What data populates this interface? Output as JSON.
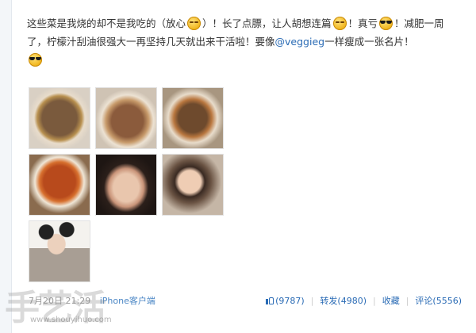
{
  "post": {
    "segments": [
      {
        "kind": "text",
        "value": "这些菜是我烧的却不是我吃的（放心"
      },
      {
        "kind": "emoji",
        "name": "smile-emoji"
      },
      {
        "kind": "text",
        "value": "）！长了点膘，让人胡想连篇"
      },
      {
        "kind": "emoji",
        "name": "smile-emoji"
      },
      {
        "kind": "text",
        "value": "！真亏"
      },
      {
        "kind": "emoji",
        "name": "cool-emoji"
      },
      {
        "kind": "text",
        "value": "！减肥一周了，柠檬汁刮油很强大一再坚持几天就出来干活啦！要像"
      },
      {
        "kind": "mention",
        "value": "@veggieg"
      },
      {
        "kind": "text",
        "value": "一样瘦成一张名片！"
      },
      {
        "kind": "emoji",
        "name": "cool-emoji"
      }
    ]
  },
  "photos": [
    {
      "name": "photo-dish-1"
    },
    {
      "name": "photo-dish-2"
    },
    {
      "name": "photo-dish-3"
    },
    {
      "name": "photo-dish-4"
    },
    {
      "name": "photo-portrait-1"
    },
    {
      "name": "photo-portrait-2"
    },
    {
      "name": "photo-portrait-3"
    }
  ],
  "footer": {
    "time": "7月20日 21:29",
    "client": "iPhone客户端",
    "like_count": "(9787)",
    "repost_label": "转发(4980)",
    "favorite_label": "收藏",
    "comment_label": "评论(5556)"
  },
  "watermark": {
    "logo_text": "手艺活",
    "url": "www.shouyihuo.com"
  },
  "colors": {
    "link": "#2a6bb5",
    "text": "#333333",
    "muted": "#999999"
  }
}
